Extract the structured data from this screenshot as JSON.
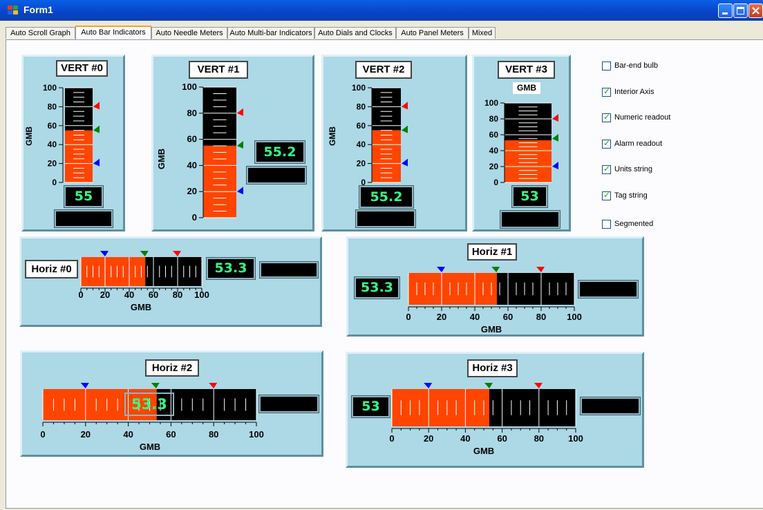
{
  "window": {
    "title": "Form1"
  },
  "tabs": [
    {
      "label": "Auto Scroll Graph",
      "active": false
    },
    {
      "label": "Auto Bar Indicators",
      "active": true
    },
    {
      "label": "Auto Needle Meters",
      "active": false
    },
    {
      "label": "Auto Multi-bar Indicators",
      "active": false
    },
    {
      "label": "Auto Dials and Clocks",
      "active": false
    },
    {
      "label": "Auto Panel Meters",
      "active": false
    },
    {
      "label": "Mixed",
      "active": false
    }
  ],
  "colors": {
    "bar_fill": "#ff4500",
    "bar_bg": "#000000",
    "panel": "#add8e6",
    "readout_text": "#33ff88",
    "alarm_hi": "#ff0000",
    "alarm_setpoint": "#008000",
    "alarm_lo": "#0000ff"
  },
  "options": [
    {
      "label": "Bar-end bulb",
      "checked": false
    },
    {
      "label": "Interior Axis",
      "checked": true
    },
    {
      "label": "Numeric readout",
      "checked": true
    },
    {
      "label": "Alarm readout",
      "checked": true
    },
    {
      "label": "Units string",
      "checked": true
    },
    {
      "label": "Tag string",
      "checked": true
    },
    {
      "label": "Segmented",
      "checked": false
    }
  ],
  "indicators": [
    {
      "tag": "VERT #0",
      "units": "GMB",
      "orientation": "vertical",
      "value": 55,
      "readout": "55",
      "axis_min": 0,
      "axis_max": 100,
      "ticks": [
        "0",
        "20",
        "40",
        "60",
        "80",
        "100"
      ],
      "alarm_hi": 80,
      "setpoint": 55,
      "alarm_lo": 20
    },
    {
      "tag": "VERT #1",
      "units": "GMB",
      "orientation": "vertical",
      "value": 55.2,
      "readout": "55.2",
      "axis_min": 0,
      "axis_max": 100,
      "ticks": [
        "0",
        "20",
        "40",
        "60",
        "80",
        "100"
      ],
      "alarm_hi": 80,
      "setpoint": 55,
      "alarm_lo": 20
    },
    {
      "tag": "VERT #2",
      "units": "GMB",
      "orientation": "vertical",
      "value": 55.2,
      "readout": "55.2",
      "axis_min": 0,
      "axis_max": 100,
      "ticks": [
        "0",
        "20",
        "40",
        "60",
        "80",
        "100"
      ],
      "alarm_hi": 80,
      "setpoint": 55,
      "alarm_lo": 20
    },
    {
      "tag": "VERT #3",
      "units": "GMB",
      "orientation": "vertical",
      "value": 53,
      "readout": "53",
      "axis_min": 0,
      "axis_max": 100,
      "ticks": [
        "0",
        "20",
        "40",
        "60",
        "80",
        "100"
      ],
      "alarm_hi": 80,
      "setpoint": 55,
      "alarm_lo": 20
    },
    {
      "tag": "Horiz #0",
      "units": "GMB",
      "orientation": "horizontal",
      "value": 53.3,
      "readout": "53.3",
      "axis_min": 0,
      "axis_max": 100,
      "ticks": [
        "0",
        "20",
        "40",
        "60",
        "80",
        "100"
      ],
      "alarm_hi": 80,
      "setpoint": 53,
      "alarm_lo": 20
    },
    {
      "tag": "Horiz #1",
      "units": "GMB",
      "orientation": "horizontal",
      "value": 53.3,
      "readout": "53.3",
      "axis_min": 0,
      "axis_max": 100,
      "ticks": [
        "0",
        "20",
        "40",
        "60",
        "80",
        "100"
      ],
      "alarm_hi": 80,
      "setpoint": 53,
      "alarm_lo": 20
    },
    {
      "tag": "Horiz #2",
      "units": "GMB",
      "orientation": "horizontal",
      "value": 53.3,
      "readout": "53.3",
      "axis_min": 0,
      "axis_max": 100,
      "ticks": [
        "0",
        "20",
        "40",
        "60",
        "80",
        "100"
      ],
      "alarm_hi": 80,
      "setpoint": 53,
      "alarm_lo": 20
    },
    {
      "tag": "Horiz #3",
      "units": "GMB",
      "orientation": "horizontal",
      "value": 53,
      "readout": "53",
      "axis_min": 0,
      "axis_max": 100,
      "ticks": [
        "0",
        "20",
        "40",
        "60",
        "80",
        "100"
      ],
      "alarm_hi": 80,
      "setpoint": 53,
      "alarm_lo": 20
    }
  ]
}
